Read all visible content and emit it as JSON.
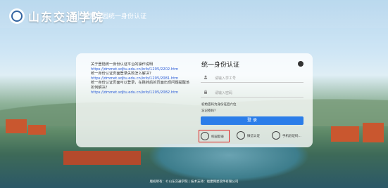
{
  "header": {
    "school_name": "山东交通学院",
    "system_name": "智慧校园统一身份认证"
  },
  "help": {
    "lines": [
      {
        "text": "关于登陆统一身份认证平台的操作说明",
        "link": false
      },
      {
        "text": "https://dmmet.sdjtu.edu.cn/info/1205/2202.htm",
        "link": true
      },
      {
        "text": "统一身份认证页面登录失败怎么解决？",
        "link": false
      },
      {
        "text": "https://dmmet.sdjtu.edu.cn/info/1205/2081.htm",
        "link": true
      },
      {
        "text": "统一身份认证页面可以登录，在跳转后的页面出现问题提醒该如何解决？",
        "link": false
      },
      {
        "text": "https://dmmet.sdjtu.edu.cn/info/1205/2082.htm",
        "link": true
      }
    ]
  },
  "login": {
    "title": "统一身份认证",
    "username_placeholder": "请输入学工号",
    "password_placeholder": "请输入密码",
    "first_login_text": "初始密码为身份证后六位",
    "forgot_text": "忘记密码？",
    "login_button": "登 录",
    "alt_methods": [
      {
        "label": "校园登录",
        "icon": "campus-icon",
        "highlighted": true
      },
      {
        "label": "微信认证",
        "icon": "wechat-icon",
        "highlighted": false
      },
      {
        "label": "手机验证码...",
        "icon": "phone-icon",
        "highlighted": false
      }
    ]
  },
  "footer": {
    "text": "版权所有：©山东交通学院 | 技术支持：福建网星软件有限公司"
  },
  "colors": {
    "primary": "#2b7de9",
    "highlight": "#e02020",
    "link": "#2a5bd7"
  }
}
